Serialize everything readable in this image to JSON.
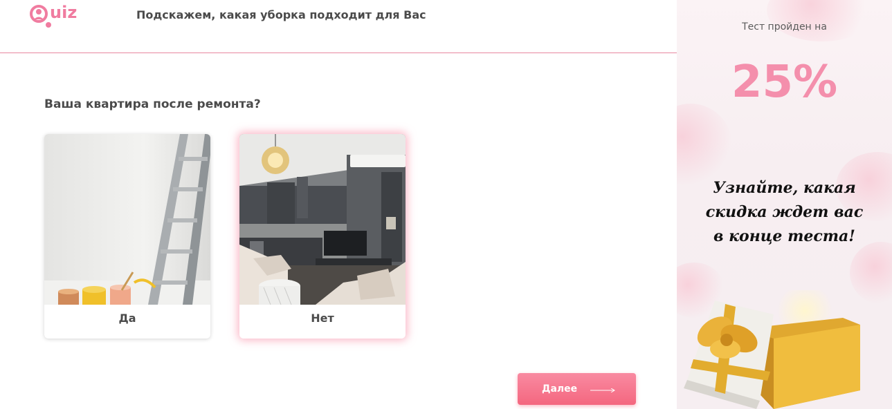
{
  "header": {
    "logo_text": "uiz",
    "title": "Подскажем, какая уборка подходит для Вас"
  },
  "question": "Ваша квартира после ремонта?",
  "options": [
    {
      "label": "Да",
      "image": "ladder-paint-photo",
      "selected": false
    },
    {
      "label": "Нет",
      "image": "modern-apartment-photo",
      "selected": true
    }
  ],
  "next_button": {
    "label": "Далее",
    "icon": "arrow-right-icon"
  },
  "sidebar": {
    "progress_label": "Тест пройден на",
    "progress_value": "25%",
    "promo_lines": [
      "Узнайте, какая",
      "скидка ждет вас",
      "в конце теста!"
    ],
    "image": "gift-box-image"
  },
  "colors": {
    "accent": "#f4677f",
    "progress": "#f48fac",
    "divider": "#e8879f"
  }
}
